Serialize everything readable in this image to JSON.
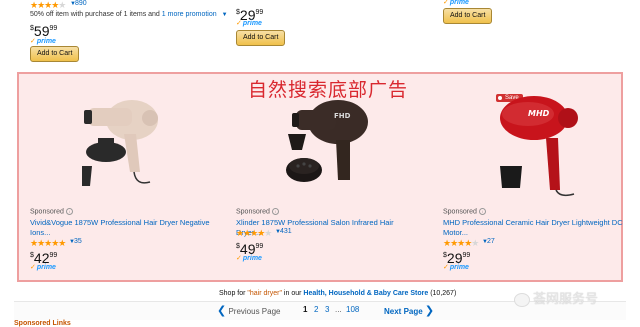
{
  "top_row": {
    "item1": {
      "review_count": "890",
      "promo_text": "50% off item with purchase of 1 items and",
      "promo_link": "1 more promotion",
      "price_dollars": "59",
      "price_cents": "99",
      "prime": "prime",
      "button": "Add to Cart"
    },
    "item2": {
      "price_dollars": "29",
      "price_cents": "99",
      "prime": "prime",
      "button": "Add to Cart"
    },
    "item3": {
      "prime": "prime",
      "button": "Add to Cart"
    }
  },
  "overlay_caption": "自然搜索底部广告",
  "sponsored": [
    {
      "label": "Sponsored",
      "title": "Vivid&Vogue 1875W Professional Hair Dryer Negative Ions...",
      "review_count": "35",
      "rating": 5,
      "price_dollars": "42",
      "price_cents": "99",
      "prime": "prime",
      "colors": {
        "body": "#e3cdbf",
        "accent": "#2b2b2b"
      }
    },
    {
      "label": "Sponsored",
      "title": "Xlinder 1875W Professional Salon Infrared Hair Dryer...",
      "review_count": "431",
      "rating": 4,
      "price_dollars": "49",
      "price_cents": "99",
      "prime": "prime",
      "brand_logo": "FHD",
      "colors": {
        "body": "#3a2b26",
        "accent": "#1f1a18"
      }
    },
    {
      "label": "Sponsored",
      "title": "MHD Professional Ceramic Hair Dryer Lightweight DC Motor...",
      "review_count": "27",
      "rating": 4.5,
      "price_dollars": "29",
      "price_cents": "99",
      "prime": "prime",
      "save_badge": "Save",
      "brand_logo": "MHD",
      "colors": {
        "body": "#c8141c",
        "accent": "#1a1a1a"
      }
    }
  ],
  "shop_line": {
    "prefix": "Shop for",
    "query": "\"hair dryer\"",
    "middle": "in our",
    "category": "Health, Household & Baby Care Store",
    "count": "(10,267)"
  },
  "pagination": {
    "previous": "Previous Page",
    "pages": [
      "1",
      "2",
      "3",
      "...",
      "108"
    ],
    "next": "Next Page"
  },
  "watermark": "荟网服务号",
  "bottom_cut": "Sponsored Links"
}
